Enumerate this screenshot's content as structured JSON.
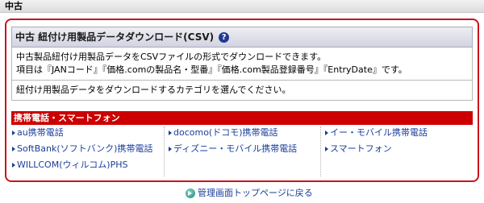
{
  "top_bar": {
    "label": "中古"
  },
  "panel": {
    "title": "中古 紐付け用製品データダウンロード(CSV)",
    "help_icon": "question-circle-icon",
    "description_line1": "中古製品紐付け用製品データをCSVファイルの形式でダウンロードできます。",
    "description_line2": "項目は『JANコード』『価格.comの製品名・型番』『価格.com製品登録番号』『EntryDate』です。",
    "instruction": "紐付け用製品データをダウンロードするカテゴリを選んでください。"
  },
  "category": {
    "header": "携帯電話・スマートフォン",
    "columns": [
      [
        "au携帯電話",
        "SoftBank(ソフトバンク)携帯電話",
        "WILLCOM(ウィルコム)PHS"
      ],
      [
        "docomo(ドコモ)携帯電話",
        "ディズニー・モバイル携帯電話"
      ],
      [
        "イー・モバイル携帯電話",
        "スマートフォン"
      ]
    ]
  },
  "footer": {
    "back_link": "管理画面トップページに戻る",
    "back_icon": "arrow-circle-icon"
  },
  "colors": {
    "accent_red": "#cc0000",
    "panel_border": "#c8141e",
    "link_blue": "#1a3e9c"
  }
}
